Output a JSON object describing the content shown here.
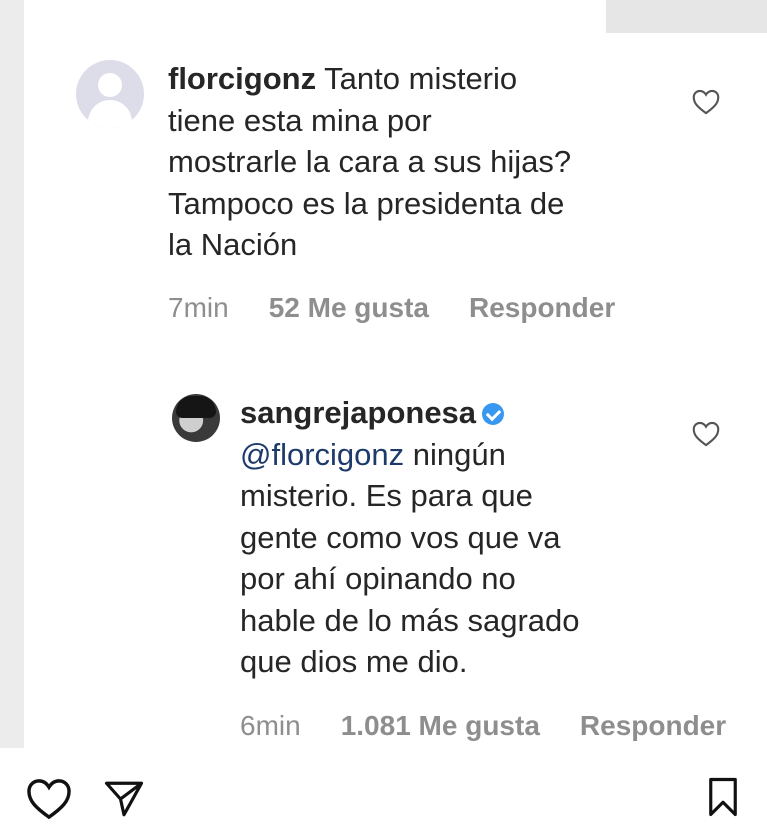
{
  "comments": [
    {
      "username": "florcigonz",
      "lines": [
        "Tanto misterio",
        "tiene esta mina por",
        "mostrarle la cara a sus hijas?",
        "Tampoco es la presidenta de",
        "la Nación"
      ],
      "time": "7min",
      "likes": "52 Me gusta",
      "reply": "Responder"
    },
    {
      "username": "sangrejaponesa",
      "mention": "@florcigonz",
      "lines": [
        "ningún",
        "misterio. Es para que",
        "gente como vos que va",
        "por ahí opinando no",
        "hable de lo más sagrado",
        "que dios me dio."
      ],
      "time": "6min",
      "likes": "1.081 Me gusta",
      "reply": "Responder"
    }
  ],
  "icons": {
    "comment_like": "heart-outline-icon",
    "verified": "verified-badge-icon",
    "bottom_like": "heart-icon",
    "bottom_share": "paper-plane-icon",
    "bottom_save": "bookmark-icon"
  }
}
